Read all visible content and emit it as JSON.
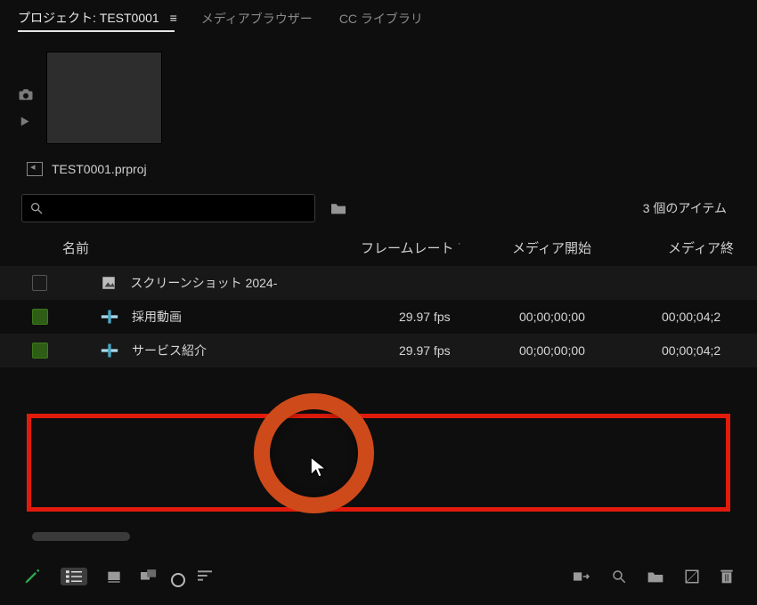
{
  "tabs": {
    "project_prefix": "プロジェクト: ",
    "project_name": "TEST0001",
    "media_browser": "メディアブラウザー",
    "cc_libraries": "CC ライブラリ"
  },
  "project_file": "TEST0001.prproj",
  "search": {
    "placeholder": ""
  },
  "item_count": "3 個のアイテム",
  "columns": {
    "name": "名前",
    "framerate": "フレームレート",
    "media_start": "メディア開始",
    "media_end": "メディア終"
  },
  "rows": [
    {
      "chip": "gray",
      "icon": "image",
      "name": "スクリーンショット 2024-",
      "fps": "",
      "start": "",
      "end": ""
    },
    {
      "chip": "green",
      "icon": "seq",
      "name": "採用動画",
      "fps": "29.97 fps",
      "start": "00;00;00;00",
      "end": "00;00;04;2"
    },
    {
      "chip": "green",
      "icon": "seq",
      "name": "サービス紹介",
      "fps": "29.97 fps",
      "start": "00;00;00;00",
      "end": "00;00;04;2"
    }
  ],
  "icons": {
    "camera": "camera-icon",
    "play": "play-icon",
    "search": "search-icon",
    "folder": "folder-icon",
    "pencil": "pencil-icon",
    "list": "list-view-icon",
    "grid": "grid-view-icon",
    "freeform": "freeform-view-icon",
    "zoom_slider": "zoom-slider",
    "sort": "sort-icon",
    "auto": "auto-icon",
    "find": "find-icon",
    "new_bin": "new-bin-icon",
    "new_item": "new-item-icon",
    "trash": "trash-icon"
  }
}
